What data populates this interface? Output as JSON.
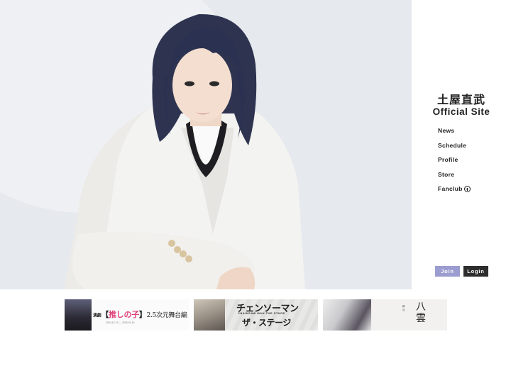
{
  "site": {
    "name": "土屋直武",
    "subtitle": "Official Site"
  },
  "nav": {
    "items": [
      "News",
      "Schedule",
      "Profile",
      "Store",
      "Fanclub"
    ]
  },
  "auth": {
    "join_label": "Join",
    "login_label": "Login"
  },
  "banners": [
    {
      "title_prefix": "演劇",
      "title_bracket_open": "【",
      "title_main": "推しの子",
      "title_bracket_close": "】",
      "title_suffix": "2.5次元舞台編",
      "dates": "2024.12.13 — 2025.01.19"
    },
    {
      "title_line1": "チェンソーマン",
      "title_line2": "CHAINSAW MAN THE STAGE",
      "title_line3": "ザ・ステージ"
    },
    {
      "title": "八雲",
      "vertical_text": "舞台"
    }
  ],
  "colors": {
    "join_button": "#9b9ccf",
    "login_button": "#2d2d2d",
    "accent_pink": "#e0427b"
  }
}
